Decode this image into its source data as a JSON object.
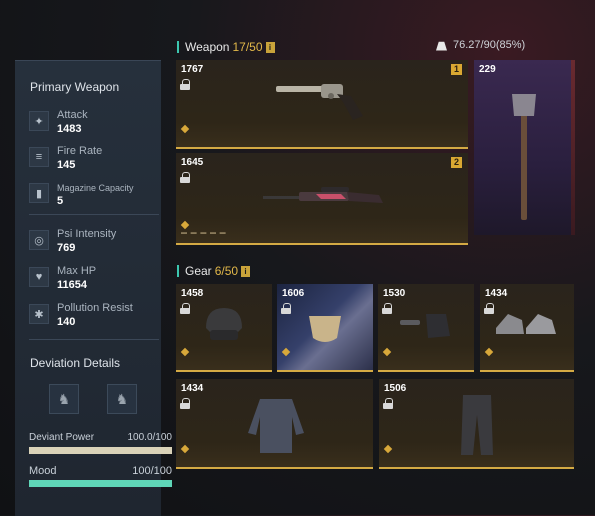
{
  "left_panel": {
    "title": "Primary Weapon",
    "stats": [
      {
        "name": "Attack",
        "value": "1483",
        "icon": "attack-icon"
      },
      {
        "name": "Fire Rate",
        "value": "145",
        "icon": "fire-rate-icon"
      },
      {
        "name": "Magazine Capacity",
        "value": "5",
        "icon": "magazine-icon"
      },
      {
        "name": "Psi Intensity",
        "value": "769",
        "icon": "psi-icon"
      },
      {
        "name": "Max HP",
        "value": "11654",
        "icon": "heart-icon"
      },
      {
        "name": "Pollution Resist",
        "value": "140",
        "icon": "pollution-icon"
      }
    ],
    "deviation_title": "Deviation Details",
    "deviant_power": {
      "label": "Deviant Power",
      "value": "100.0/100",
      "fraction": 1.0,
      "color": "#d9d2b8"
    },
    "mood": {
      "label": "Mood",
      "value": "100/100",
      "fraction": 1.0,
      "color": "#5fd6b8"
    }
  },
  "weapon_section": {
    "title": "Weapon",
    "count": "17/50",
    "weight": "76.27/90(85%)",
    "cards": [
      {
        "score": "1767",
        "rank": "1"
      },
      {
        "score": "1645",
        "rank": "2"
      },
      {
        "score": "229",
        "rank": ""
      }
    ]
  },
  "gear_section": {
    "title": "Gear",
    "count": "6/50",
    "cards": [
      {
        "score": "1458"
      },
      {
        "score": "1606"
      },
      {
        "score": "1530"
      },
      {
        "score": "1434"
      },
      {
        "score": "1434"
      },
      {
        "score": "1506"
      }
    ]
  },
  "colors": {
    "accent_gold": "#d4aa44",
    "accent_teal": "#3cc7b0",
    "panel": "#232b36"
  }
}
